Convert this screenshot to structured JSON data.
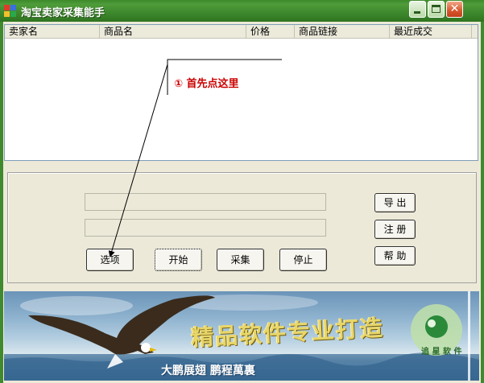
{
  "window": {
    "title": "淘宝卖家采集能手",
    "icon": "taobao-app-icon",
    "controls": {
      "minimize": "minimize-icon",
      "maximize": "maximize-icon",
      "close": "close-icon"
    }
  },
  "list": {
    "columns": [
      "卖家名",
      "商品名",
      "价格",
      "商品链接",
      "最近成交"
    ],
    "rows": []
  },
  "annotation": {
    "text": "①  首先点这里",
    "color": "#cc0000"
  },
  "form": {
    "field1": {
      "value": "",
      "placeholder": ""
    },
    "field2": {
      "value": "",
      "placeholder": ""
    }
  },
  "buttons": {
    "options": "选项",
    "start": "开始",
    "collect": "采集",
    "stop": "停止",
    "export": "导 出",
    "register": "注 册",
    "help": "帮 助"
  },
  "banner": {
    "slogan": "精品软件专业打造",
    "motto": "大鹏展翅  鹏程萬裏",
    "seal": "追 星  软 件"
  },
  "colors": {
    "titlebar": "#3f8a2e",
    "face": "#ece9d8",
    "annotation": "#cc0000"
  }
}
